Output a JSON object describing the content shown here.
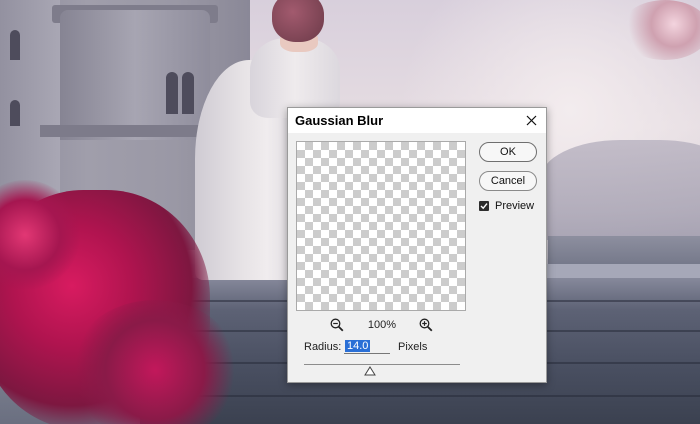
{
  "dialog": {
    "title": "Gaussian Blur",
    "ok_label": "OK",
    "cancel_label": "Cancel",
    "preview_label": "Preview",
    "preview_checked": true,
    "zoom": {
      "level": "100%"
    },
    "radius": {
      "label": "Radius:",
      "value": "14.0",
      "unit": "Pixels",
      "slider_fraction": 0.42
    }
  },
  "icons": {
    "close": "close-icon",
    "zoom_out": "zoom-out-icon",
    "zoom_in": "zoom-in-icon",
    "checkbox": "checkmark-icon",
    "slider_thumb": "triangle-thumb-icon"
  },
  "colors": {
    "selection_highlight": "#2a6fd6",
    "dialog_bg": "#f0f0f0"
  }
}
